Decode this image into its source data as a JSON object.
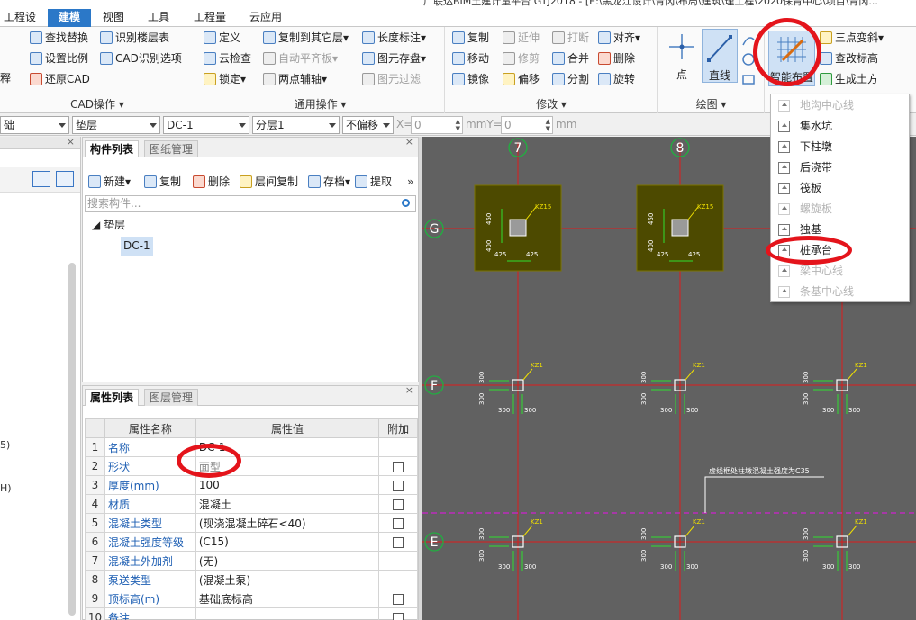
{
  "window": {
    "title_fragment": "广联达BIM土建计量平台 GTJ2018 - [E:\\黑龙江设计\\青冈\\布局\\建筑\\理工程\\2020保青中心\\项目\\青冈..."
  },
  "menu_tabs": [
    {
      "label": "工程设置",
      "active": false
    },
    {
      "label": "建模",
      "active": true
    },
    {
      "label": "视图",
      "active": false
    },
    {
      "label": "工具",
      "active": false
    },
    {
      "label": "工程量",
      "active": false
    },
    {
      "label": "云应用",
      "active": false
    }
  ],
  "ribbon": {
    "cad_group": {
      "title": "CAD操作",
      "left_cut": "释",
      "buttons": [
        "查找替换",
        "识别楼层表",
        "设置比例",
        "CAD识别选项",
        "还原CAD"
      ]
    },
    "general_group": {
      "title": "通用操作",
      "buttons": [
        {
          "label": "定义",
          "enabled": true
        },
        {
          "label": "复制到其它层",
          "enabled": true
        },
        {
          "label": "长度标注",
          "enabled": true
        },
        {
          "label": "云检查",
          "enabled": true
        },
        {
          "label": "自动平齐板",
          "enabled": false
        },
        {
          "label": "图元存盘",
          "enabled": true
        },
        {
          "label": "锁定",
          "enabled": true
        },
        {
          "label": "两点辅轴",
          "enabled": true
        },
        {
          "label": "图元过滤",
          "enabled": false
        }
      ]
    },
    "modify_group": {
      "title": "修改",
      "buttons": [
        {
          "label": "复制",
          "enabled": true
        },
        {
          "label": "延伸",
          "enabled": false
        },
        {
          "label": "打断",
          "enabled": false
        },
        {
          "label": "对齐",
          "enabled": true
        },
        {
          "label": "移动",
          "enabled": true
        },
        {
          "label": "修剪",
          "enabled": false
        },
        {
          "label": "合并",
          "enabled": true
        },
        {
          "label": "删除",
          "enabled": true
        },
        {
          "label": "镜像",
          "enabled": true
        },
        {
          "label": "偏移",
          "enabled": true
        },
        {
          "label": "分割",
          "enabled": true
        },
        {
          "label": "旋转",
          "enabled": true
        }
      ]
    },
    "draw_group": {
      "title": "绘图",
      "point": "点",
      "line": "直线"
    },
    "smart_group": {
      "smart_layout": "智能布置",
      "buttons": [
        "三点变斜",
        "查改标高",
        "生成土方"
      ]
    }
  },
  "smart_dropdown": [
    {
      "label": "地沟中心线",
      "enabled": false
    },
    {
      "label": "集水坑",
      "enabled": true
    },
    {
      "label": "下柱墩",
      "enabled": true
    },
    {
      "label": "后浇带",
      "enabled": true
    },
    {
      "label": "筏板",
      "enabled": true
    },
    {
      "label": "螺旋板",
      "enabled": false
    },
    {
      "label": "独基",
      "enabled": true
    },
    {
      "label": "桩承台",
      "enabled": true
    },
    {
      "label": "梁中心线",
      "enabled": false
    },
    {
      "label": "条基中心线",
      "enabled": false
    }
  ],
  "toolbar": {
    "combo1": "础",
    "combo2": "垫层",
    "combo3": "DC-1",
    "combo4": "分层1",
    "combo5": "不偏移",
    "x_label": "X=",
    "x_value": "0",
    "mmY_label": "mmY=",
    "y_value": "0",
    "mm_label": "mm"
  },
  "left_stub": {
    "t1": "5)",
    "t2": "H)"
  },
  "component_panel": {
    "tabs": [
      "构件列表",
      "图纸管理"
    ],
    "tools": [
      "新建",
      "复制",
      "删除",
      "层间复制",
      "存档",
      "提取"
    ],
    "search_placeholder": "搜索构件...",
    "tree_parent": "垫层",
    "tree_child": "DC-1"
  },
  "property_panel": {
    "tabs": [
      "属性列表",
      "图层管理"
    ],
    "headers": [
      "属性名称",
      "属性值",
      "附加"
    ],
    "rows": [
      {
        "num": "1",
        "name": "名称",
        "value": "DC-1",
        "checkbox": false
      },
      {
        "num": "2",
        "name": "形状",
        "value": "面型",
        "checkbox": true
      },
      {
        "num": "3",
        "name": "厚度(mm)",
        "value": "100",
        "checkbox": true
      },
      {
        "num": "4",
        "name": "材质",
        "value": "混凝土",
        "checkbox": true
      },
      {
        "num": "5",
        "name": "混凝土类型",
        "value": "(现浇混凝土碎石<40)",
        "checkbox": true
      },
      {
        "num": "6",
        "name": "混凝土强度等级",
        "value": "(C15)",
        "checkbox": true
      },
      {
        "num": "7",
        "name": "混凝土外加剂",
        "value": "(无)",
        "checkbox": false
      },
      {
        "num": "8",
        "name": "泵送类型",
        "value": "(混凝土泵)",
        "checkbox": false
      },
      {
        "num": "9",
        "name": "顶标高(m)",
        "value": "基础底标高",
        "checkbox": true
      },
      {
        "num": "10",
        "name": "备注",
        "value": "",
        "checkbox": true
      }
    ]
  },
  "drawing": {
    "axis_columns": [
      "7",
      "8"
    ],
    "axis_rows": [
      "G",
      "F",
      "E"
    ],
    "pier_tag": "KZ15",
    "column_tag": "KZ1",
    "dim_a": "450",
    "dim_b": "400",
    "dim_c": "425",
    "dim_d": "300",
    "note": "虚线框处柱墩混凝土强度为C35",
    "colors": {
      "background": "#616161",
      "axis": "#e01a1a",
      "pad": "#4d4a00",
      "dim": "#30e030",
      "tag": "#f0e000"
    }
  }
}
